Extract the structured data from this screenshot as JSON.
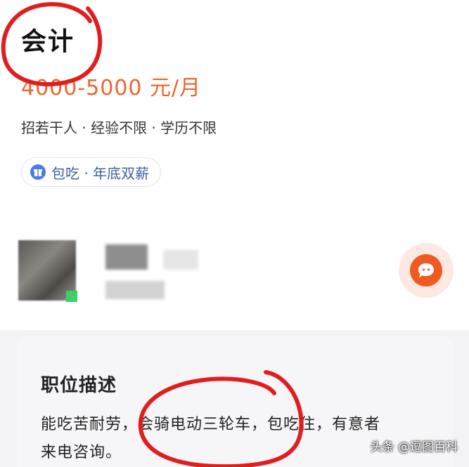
{
  "job": {
    "title": "会计",
    "salary": "4000-5000 元/月",
    "requirements": "招若干人 · 经验不限 · 学历不限",
    "benefits": "包吃 · 年底双薪"
  },
  "contact": {
    "chat_icon": "chat-bubble-icon"
  },
  "description": {
    "heading": "职位描述",
    "line1": "能吃苦耐劳，会骑电动三轮车，包吃住，有意者",
    "line2": "来电咨询。"
  },
  "watermark": "头条 @逗图百科",
  "colors": {
    "accent": "#f05a22",
    "salary": "#f0632c",
    "tag_text": "#3e5f9e",
    "annotation": "#e11e1e"
  }
}
